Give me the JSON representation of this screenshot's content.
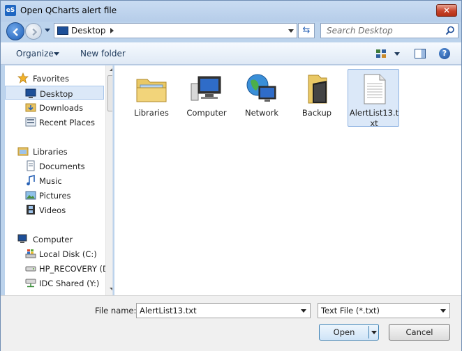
{
  "window": {
    "app_icon": "eS",
    "title": "Open QCharts alert file",
    "close_glyph": "✕"
  },
  "address": {
    "location": "Desktop",
    "search_placeholder": "Search Desktop",
    "refresh_glyph": "⇆"
  },
  "toolbar": {
    "organize_label": "Organize",
    "new_folder_label": "New folder",
    "help_glyph": "?"
  },
  "nav": {
    "favorites": {
      "label": "Favorites",
      "items": [
        "Desktop",
        "Downloads",
        "Recent Places"
      ]
    },
    "libraries": {
      "label": "Libraries",
      "items": [
        "Documents",
        "Music",
        "Pictures",
        "Videos"
      ]
    },
    "computer": {
      "label": "Computer",
      "items": [
        "Local Disk (C:)",
        "HP_RECOVERY (D",
        "IDC Shared (Y:)"
      ]
    },
    "selected": "Desktop"
  },
  "files": [
    {
      "label": "Libraries",
      "icon": "libraries-folder-icon"
    },
    {
      "label": "Computer",
      "icon": "computer-icon"
    },
    {
      "label": "Network",
      "icon": "network-icon"
    },
    {
      "label": "Backup",
      "icon": "folder-icon"
    },
    {
      "label": "AlertList13.txt",
      "icon": "text-file-icon",
      "selected": true
    }
  ],
  "bottom": {
    "file_name_label": "File name:",
    "file_name_value": "AlertList13.txt",
    "file_type_value": "Text File (*.txt)",
    "open_label": "Open",
    "cancel_label": "Cancel"
  },
  "colors": {
    "frame": "#bcd3ec",
    "selection": "#dbe8f8",
    "accent": "#1d5fb8"
  }
}
